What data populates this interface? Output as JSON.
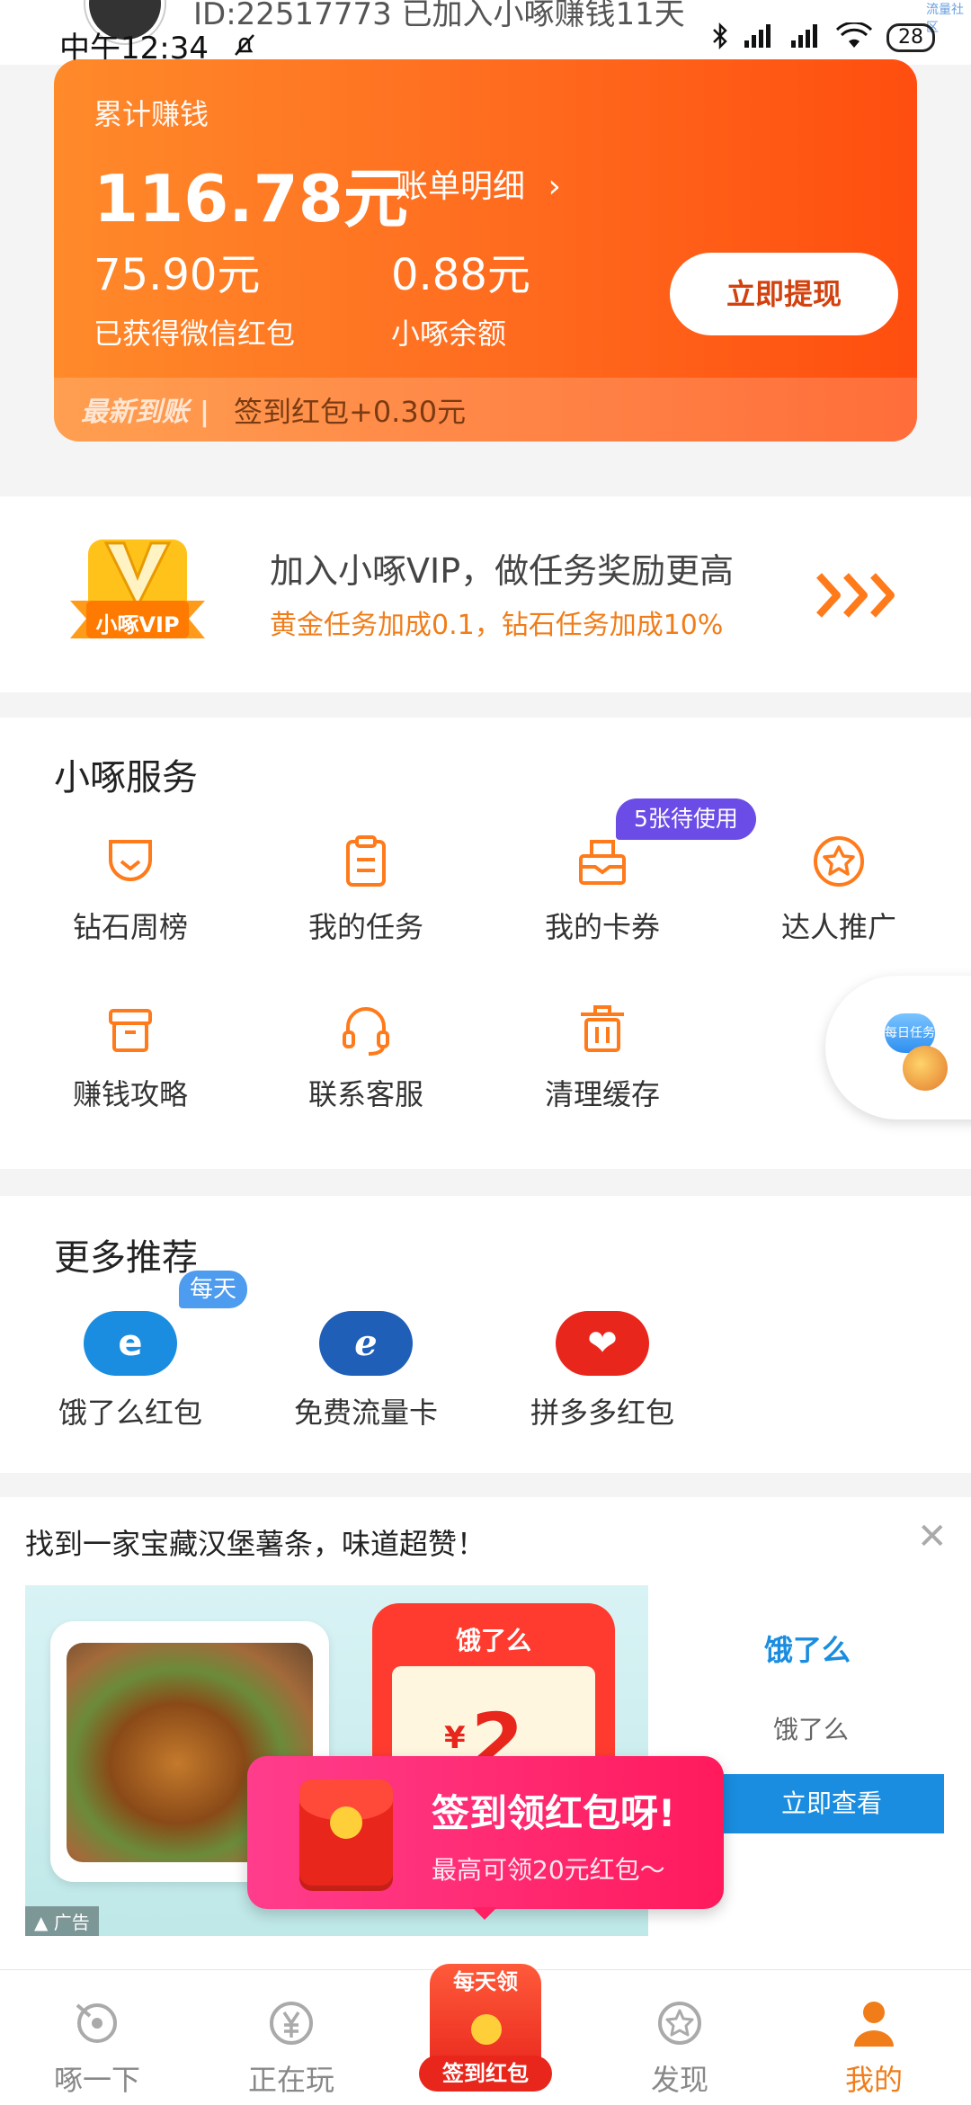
{
  "status_bar": {
    "id_text": "ID:22517773 已加入小啄赚钱11天",
    "time": "中午12:34",
    "battery": "28",
    "corner_text": "流量社区"
  },
  "earnings": {
    "label": "累计赚钱",
    "total": "116.78元",
    "bill_link": "账单明细",
    "wechat_amount": "75.90元",
    "wechat_label": "已获得微信红包",
    "balance_amount": "0.88元",
    "balance_label": "小啄余额",
    "withdraw_button": "立即提现",
    "latest_key": "最新到账",
    "latest_value": "签到红包+0.30元"
  },
  "vip": {
    "badge_text": "小啄VIP",
    "title": "加入小啄VIP，做任务奖励更高",
    "subtitle": "黄金任务加成0.1，钻石任务加成10%"
  },
  "services": {
    "title": "小啄服务",
    "badge": "5张待使用",
    "items": [
      {
        "label": "钻石周榜",
        "icon": "trophy-icon"
      },
      {
        "label": "我的任务",
        "icon": "clipboard-icon"
      },
      {
        "label": "我的卡券",
        "icon": "coupon-box-icon"
      },
      {
        "label": "达人推广",
        "icon": "star-badge-icon"
      },
      {
        "label": "赚钱攻略",
        "icon": "guide-box-icon"
      },
      {
        "label": "联系客服",
        "icon": "headset-icon"
      },
      {
        "label": "清理缓存",
        "icon": "trash-icon"
      }
    ],
    "float_label": "每日任务"
  },
  "recommend": {
    "title": "更多推荐",
    "badge": "每天",
    "items": [
      {
        "label": "饿了么红包",
        "color": "#1a8de0"
      },
      {
        "label": "免费流量卡",
        "color": "#1f5fb8"
      },
      {
        "label": "拼多多红包",
        "color": "#e8261c"
      }
    ]
  },
  "ad": {
    "title": "找到一家宝藏汉堡薯条，味道超赞！",
    "price_symbol": "¥",
    "price": "2",
    "image_logo": "饿了么",
    "ad_tag": "广告",
    "brand_logo": "饿了么",
    "brand_name": "饿了么",
    "cta": "立即查看"
  },
  "popup": {
    "title": "签到领红包呀!",
    "subtitle": "最高可领20元红包～"
  },
  "nav": {
    "items": [
      "啄一下",
      "正在玩",
      "发现",
      "我的"
    ],
    "center_top": "每天领",
    "center_bottom": "签到红包",
    "active_color": "#f07d1a"
  }
}
